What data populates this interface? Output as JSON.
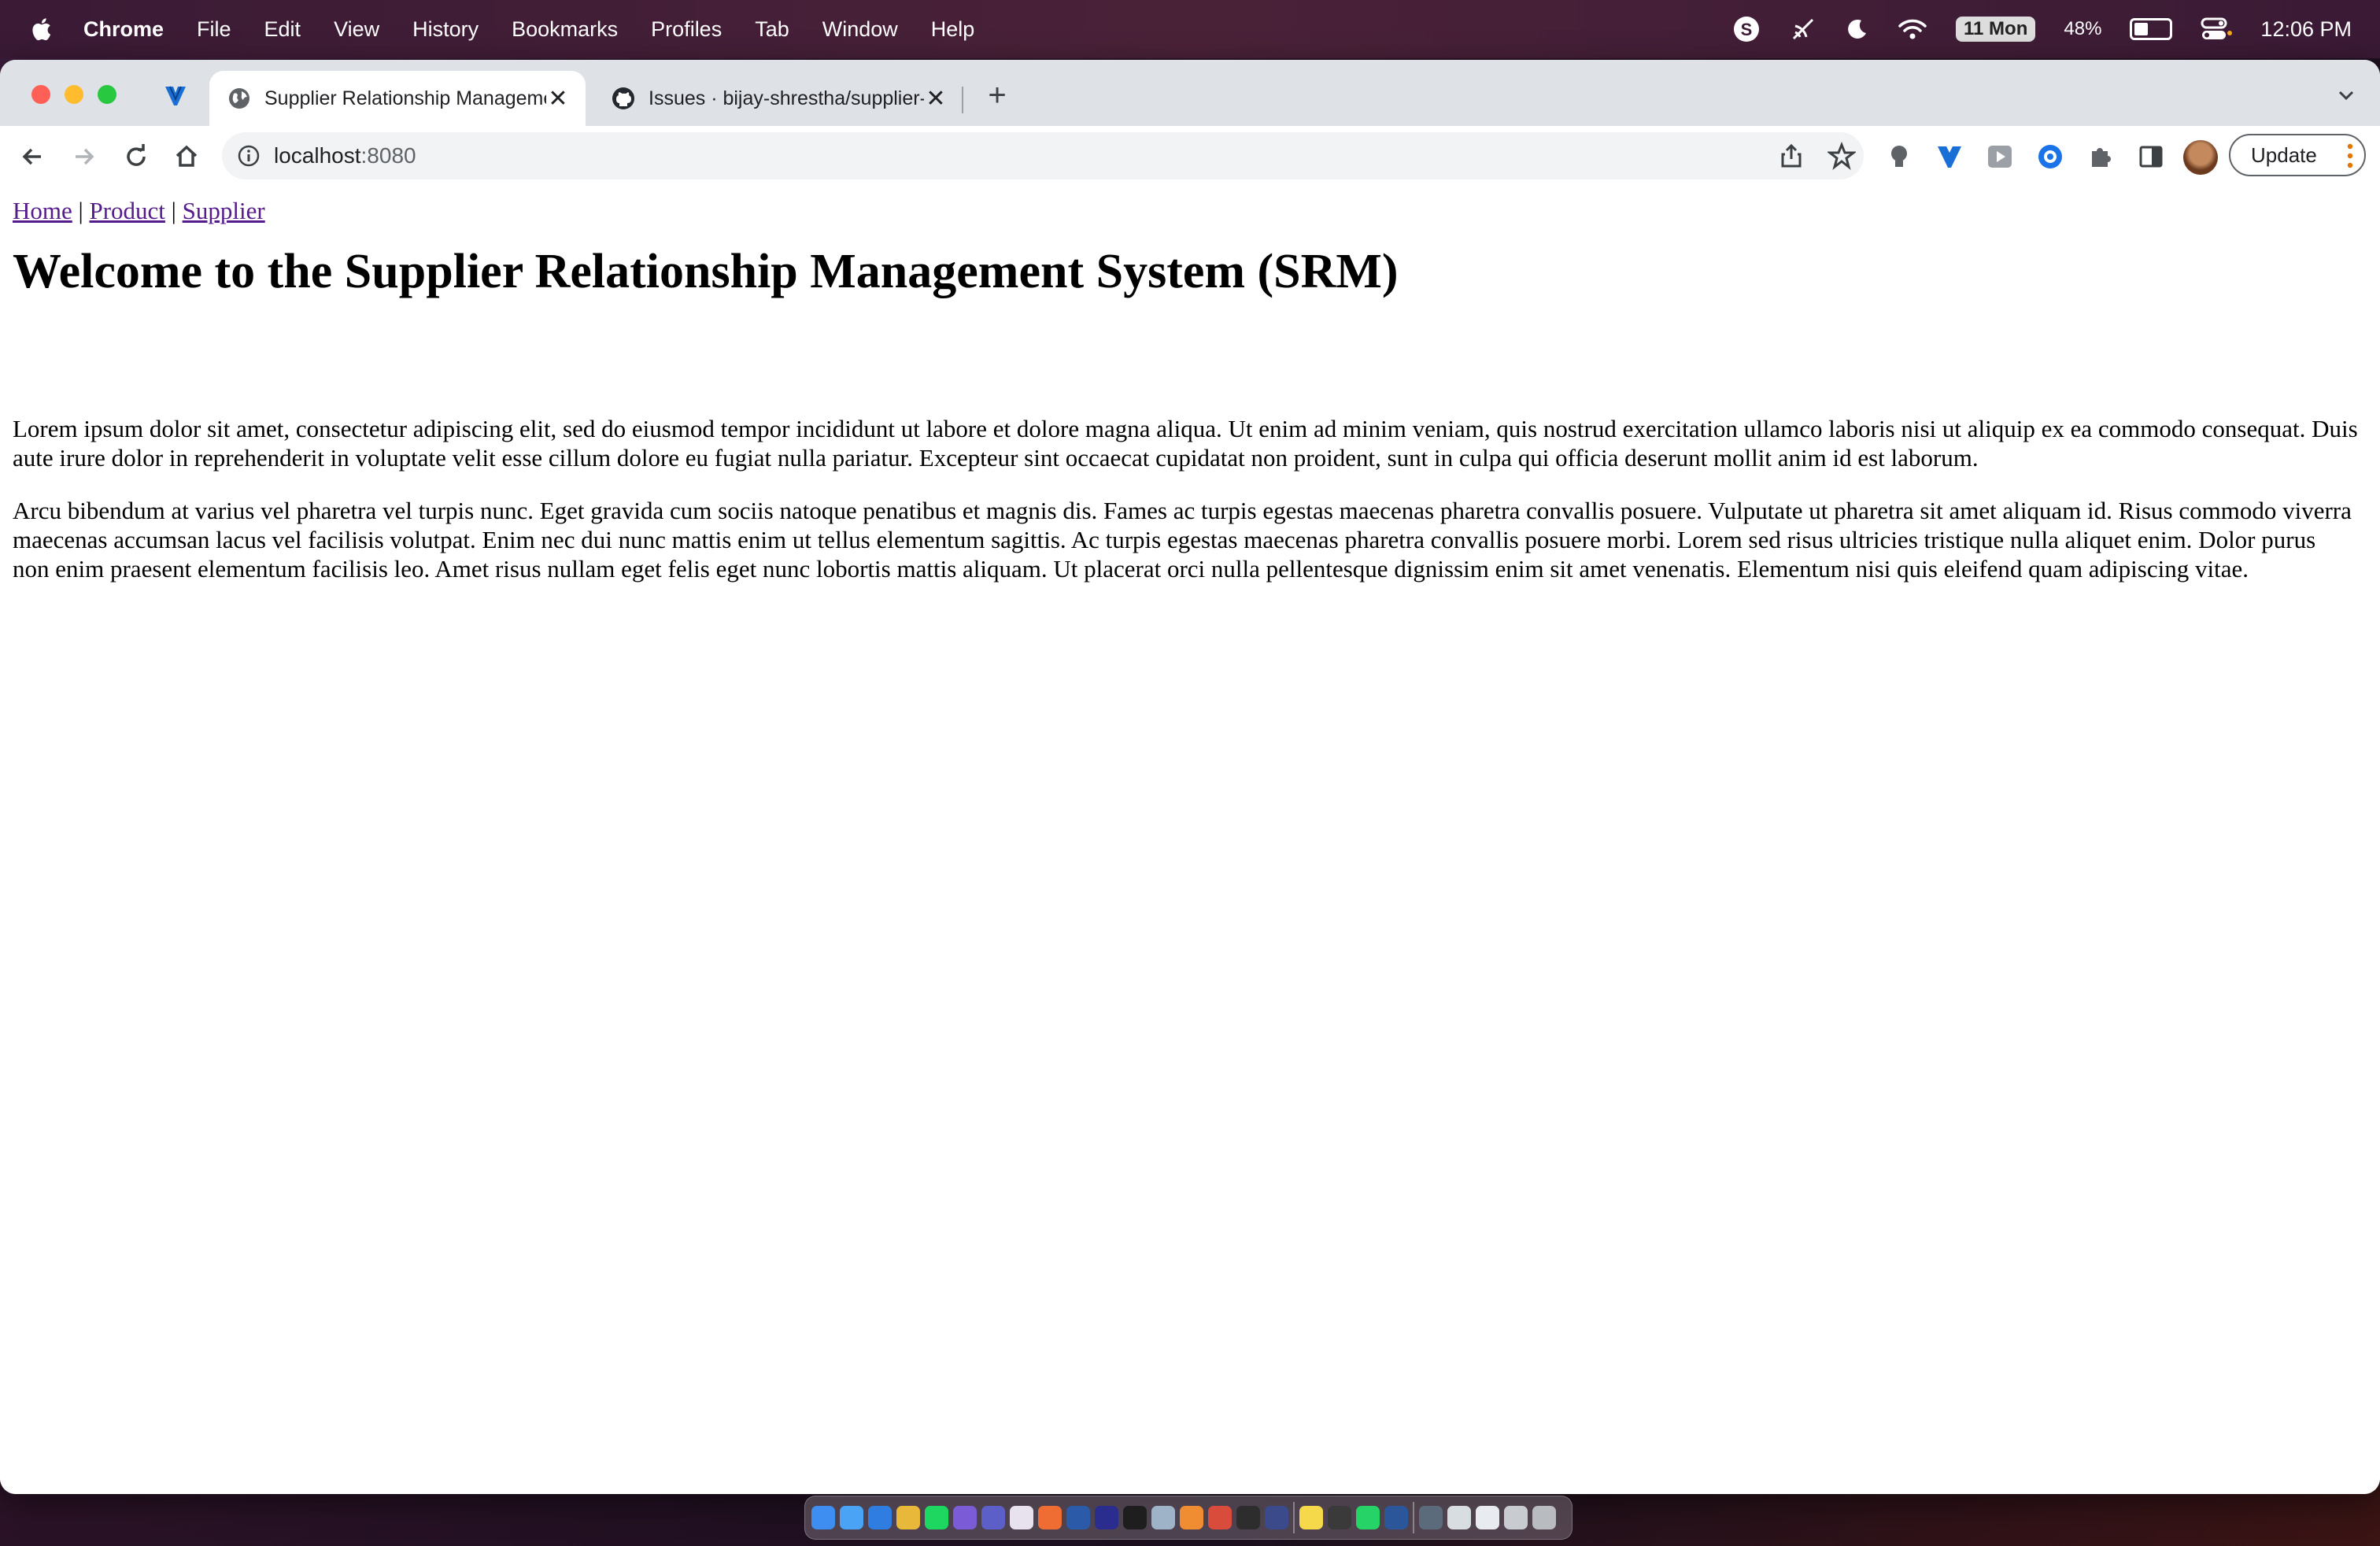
{
  "menubar": {
    "app_name": "Chrome",
    "items": [
      "File",
      "Edit",
      "View",
      "History",
      "Bookmarks",
      "Profiles",
      "Tab",
      "Window",
      "Help"
    ],
    "date_badge": "11 Mon",
    "battery_text": "48%",
    "battery_level": 0.48,
    "time": "12:06 PM"
  },
  "browser": {
    "tabs": [
      {
        "title": "Supplier Relationship Management System",
        "icon": "globe-icon",
        "active": true
      },
      {
        "title": "Issues · bijay-shrestha/supplier-relationship-management",
        "icon": "github-icon",
        "active": false
      }
    ],
    "url_host": "localhost",
    "url_port": ":8080",
    "update_label": "Update"
  },
  "page": {
    "nav": {
      "home": "Home",
      "product": "Product",
      "supplier": "Supplier",
      "separator": "|"
    },
    "heading": "Welcome to the Supplier Relationship Management System (SRM)",
    "paragraph1": "Lorem ipsum dolor sit amet, consectetur adipiscing elit, sed do eiusmod tempor incididunt ut labore et dolore magna aliqua. Ut enim ad minim veniam, quis nostrud exercitation ullamco laboris nisi ut aliquip ex ea commodo consequat. Duis aute irure dolor in reprehenderit in voluptate velit esse cillum dolore eu fugiat nulla pariatur. Excepteur sint occaecat cupidatat non proident, sunt in culpa qui officia deserunt mollit anim id est laborum.",
    "paragraph2": "Arcu bibendum at varius vel pharetra vel turpis nunc. Eget gravida cum sociis natoque penatibus et magnis dis. Fames ac turpis egestas maecenas pharetra convallis posuere. Vulputate ut pharetra sit amet aliquam id. Risus commodo viverra maecenas accumsan lacus vel facilisis volutpat. Enim nec dui nunc mattis enim ut tellus elementum sagittis. Ac turpis egestas maecenas pharetra convallis posuere morbi. Lorem sed risus ultricies tristique nulla aliquet enim. Dolor purus non enim praesent elementum facilisis leo. Amet risus nullam eget felis eget nunc lobortis mattis aliquam. Ut placerat orci nulla pellentesque dignissim enim sit amet venenatis. Elementum nisi quis eleifend quam adipiscing vitae."
  },
  "dock": {
    "apps": [
      {
        "name": "finder",
        "color": "#3d8ef0"
      },
      {
        "name": "mail",
        "color": "#4aa3f5"
      },
      {
        "name": "safari",
        "color": "#2f7de0"
      },
      {
        "name": "chrome",
        "color": "#e8b83a"
      },
      {
        "name": "spotify",
        "color": "#1ed760"
      },
      {
        "name": "viber",
        "color": "#7b5cd6"
      },
      {
        "name": "teams",
        "color": "#5b5fc7"
      },
      {
        "name": "slack",
        "color": "#e8e2ef"
      },
      {
        "name": "postman",
        "color": "#ef6c33"
      },
      {
        "name": "sourcetree",
        "color": "#2a5aa8"
      },
      {
        "name": "intellij",
        "color": "#2b2d8e"
      },
      {
        "name": "terminal-dot",
        "color": "#1e1e1e"
      },
      {
        "name": "app-store",
        "color": "#9fb3c8"
      },
      {
        "name": "sublime",
        "color": "#f08c32"
      },
      {
        "name": "git-client",
        "color": "#d94b3a"
      },
      {
        "name": "vim",
        "color": "#2d2d2d"
      },
      {
        "name": "xcode",
        "color": "#3a4a8a"
      },
      {
        "name": "notes",
        "color": "#f5d94a"
      },
      {
        "name": "photos",
        "color": "#3a3a3a"
      },
      {
        "name": "whatsapp",
        "color": "#25d366"
      },
      {
        "name": "word",
        "color": "#2b579a"
      },
      {
        "name": "folder-1",
        "color": "#5b6b7b"
      },
      {
        "name": "folder-2",
        "color": "#d8dde2"
      },
      {
        "name": "folder-3",
        "color": "#e8ecf0"
      },
      {
        "name": "folder-4",
        "color": "#c8ccd0"
      },
      {
        "name": "trash",
        "color": "#b8bcc0"
      }
    ]
  }
}
